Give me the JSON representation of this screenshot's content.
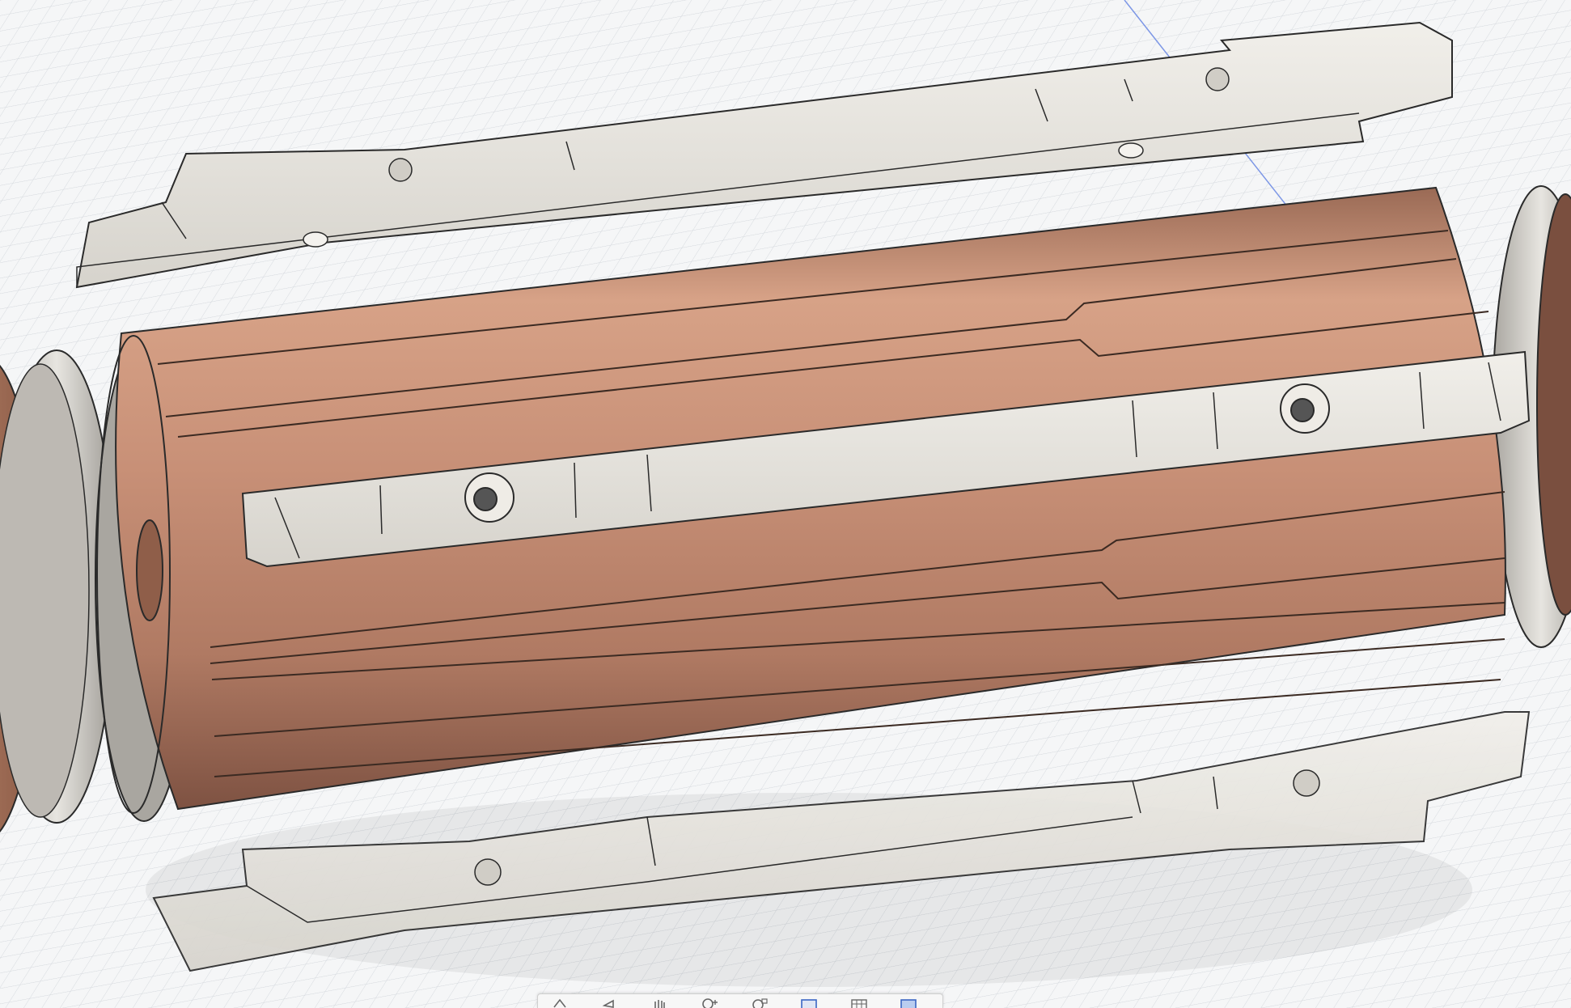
{
  "viewport": {
    "background_color": "#f5f6f7",
    "grid_color": "#c9ced4",
    "axis_color": "#5b7fe0"
  },
  "model": {
    "body_color": "#c48e74",
    "body_dark": "#8a5a45",
    "plate_color": "#e9e7e2",
    "plate_shadow": "#cfccc5",
    "ring_color": "#d8d6d0",
    "edge_color": "#2a2a2a"
  },
  "toolbar": {
    "items": [
      {
        "name": "orbit-tool",
        "icon": "orbit-icon"
      },
      {
        "name": "look-at-tool",
        "icon": "look-at-icon"
      },
      {
        "name": "pan-tool",
        "icon": "pan-hand-icon"
      },
      {
        "name": "zoom-tool",
        "icon": "zoom-icon"
      },
      {
        "name": "fit-tool",
        "icon": "zoom-window-icon"
      },
      {
        "name": "display-settings-tool",
        "icon": "display-settings-icon"
      },
      {
        "name": "grid-snaps-tool",
        "icon": "grid-icon"
      },
      {
        "name": "viewports-tool",
        "icon": "viewports-icon"
      }
    ]
  }
}
